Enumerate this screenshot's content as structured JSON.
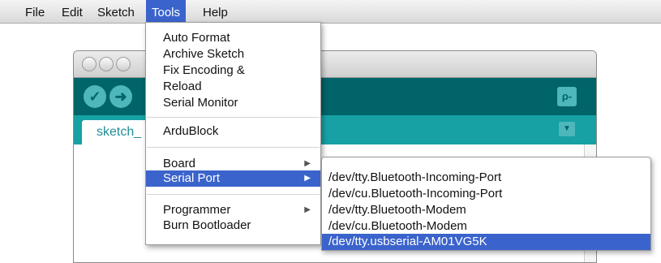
{
  "menubar": {
    "items": [
      "File",
      "Edit",
      "Sketch",
      "Tools",
      "Help"
    ],
    "active": "Tools"
  },
  "window": {
    "tab_label": "sketch_",
    "toolbar_icons": [
      "verify-icon",
      "upload-icon",
      "serial-monitor-icon"
    ]
  },
  "tools_menu": {
    "auto_format": "Auto Format",
    "archive_sketch": "Archive Sketch",
    "fix_encoding_1": "Fix Encoding &",
    "fix_encoding_2": "Reload",
    "serial_monitor": "Serial Monitor",
    "ardublock": "ArduBlock",
    "board": "Board",
    "serial_port": "Serial Port",
    "programmer": "Programmer",
    "burn_bootloader": "Burn Bootloader",
    "submenu_arrow": "▶"
  },
  "serial_port_menu": {
    "ports": [
      "/dev/tty.Bluetooth-Incoming-Port",
      "/dev/cu.Bluetooth-Incoming-Port",
      "/dev/tty.Bluetooth-Modem",
      "/dev/cu.Bluetooth-Modem",
      "/dev/tty.usbserial-AM01VG5K"
    ],
    "selected": "/dev/tty.usbserial-AM01VG5K"
  },
  "colors": {
    "highlight": "#3b63cc",
    "arduino_teal_dark": "#006468",
    "arduino_teal": "#17a1a5"
  }
}
